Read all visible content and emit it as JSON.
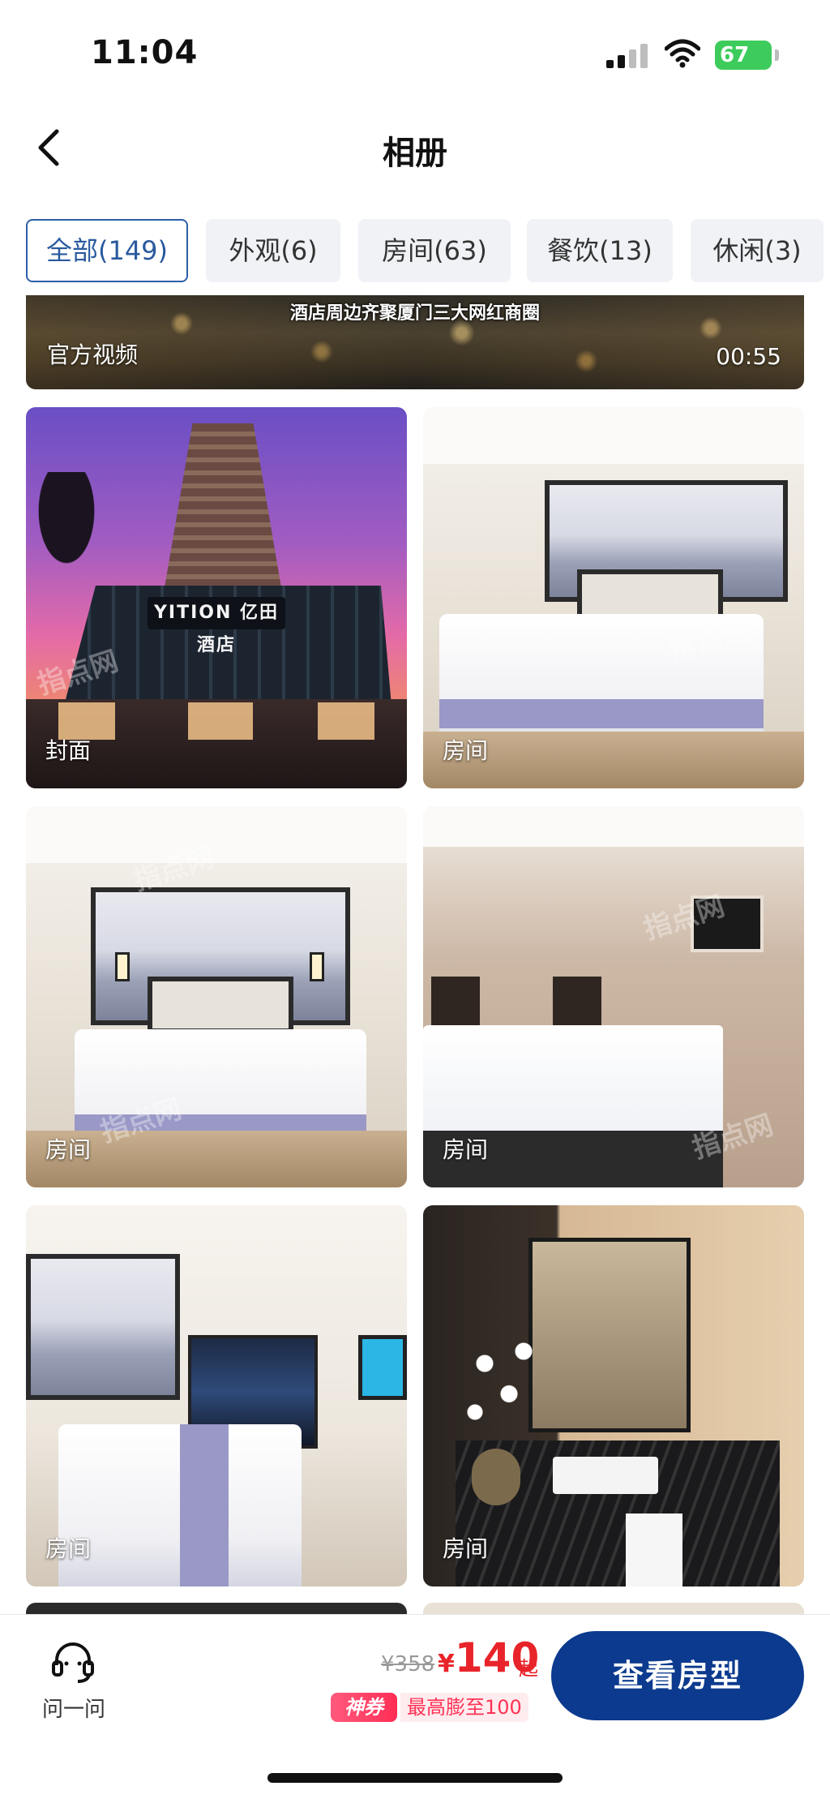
{
  "status_bar": {
    "time": "11:04",
    "battery": "67"
  },
  "header": {
    "title": "相册",
    "back_icon": "chevron-left-icon"
  },
  "tabs": [
    {
      "label": "全部(149)",
      "active": true
    },
    {
      "label": "外观(6)",
      "active": false
    },
    {
      "label": "房间(63)",
      "active": false
    },
    {
      "label": "餐饮(13)",
      "active": false
    },
    {
      "label": "休闲(3)",
      "active": false
    }
  ],
  "video": {
    "caption": "酒店周边齐聚厦门三大网红商圈",
    "label": "官方视频",
    "duration": "00:55"
  },
  "photos": [
    {
      "label": "封面",
      "sign": "YITION 亿田酒店"
    },
    {
      "label": "房间"
    },
    {
      "label": "房间"
    },
    {
      "label": "房间"
    },
    {
      "label": "房间"
    },
    {
      "label": "房间"
    }
  ],
  "watermark": "指点网",
  "bottom_bar": {
    "ask_label": "问一问",
    "ask_icon": "headset-icon",
    "price_old": "¥358",
    "price_symbol": "¥",
    "price_current": "140",
    "price_suffix": "起",
    "coupon_badge": "神券",
    "coupon_text": "最高膨至100",
    "cta_label": "查看房型"
  },
  "colors": {
    "accent_blue": "#0b3a8e",
    "tab_active": "#2a5a9e",
    "price_red": "#e8242a",
    "coupon_pink": "#ff2d55",
    "battery_green": "#3dcc5b"
  }
}
